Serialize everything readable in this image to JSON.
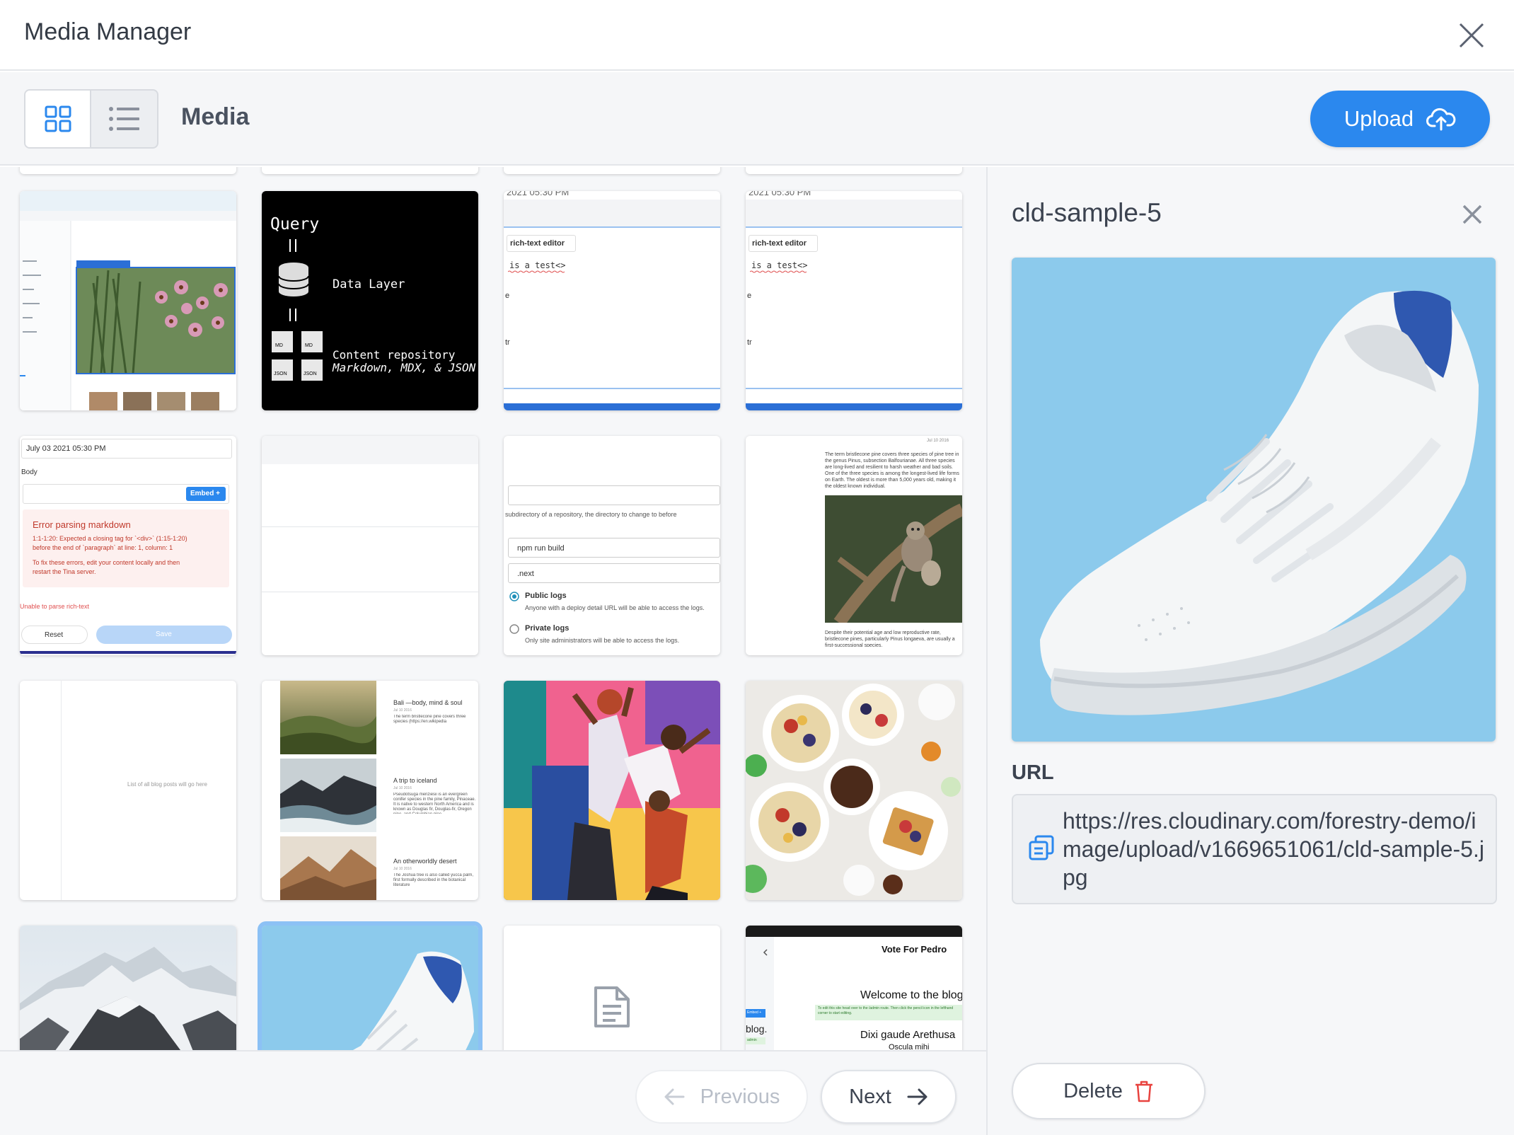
{
  "window": {
    "title": "Media Manager"
  },
  "toolbar": {
    "breadcrumb": "Media",
    "upload_label": "Upload"
  },
  "grid": {
    "tile2": {
      "query": "Query",
      "data_layer": "Data Layer",
      "content_repo": "Content repository",
      "content_formats": "Markdown, MDX, & JSON files",
      "md": "MD",
      "json": "JSON"
    },
    "tile3": {
      "date_partial": "2021 05:30 PM",
      "label": "rich-text editor",
      "code": "is a test<>",
      "line1": "e",
      "line2": "tr"
    },
    "tile4": {
      "date_partial": "2021 05:30 PM",
      "label": "rich-text editor",
      "code": "is a test<>",
      "line1": "e",
      "line2": "tr"
    },
    "tile5": {
      "date": "July 03 2021 05:30 PM",
      "body": "Body",
      "embed": "Embed +",
      "error_title": "Error parsing markdown",
      "error_1": "1:1-1:20: Expected a closing tag for `<div>` (1:15-1:20)",
      "error_2": "before the end of `paragraph` at line: 1, column: 1",
      "error_3": "To fix these errors, edit your content locally and then",
      "error_4": "restart the Tina server.",
      "unable": "Unable to parse rich-text",
      "reset": "Reset",
      "save": "Save"
    },
    "tile7": {
      "hint": "subdirectory of a repository, the directory to change to before",
      "cmd": "npm run build",
      "dir": ".next",
      "public_title": "Public logs",
      "public_desc": "Anyone with a deploy detail URL will be able to access the logs.",
      "private_title": "Private logs",
      "private_desc": "Only site administrators will be able to access the logs."
    },
    "tile8": {
      "date": "Jul 10 2016",
      "para": "The term bristlecone pine covers three species of pine tree in the genus Pinus, subsection Balfourianae. All three species are long-lived and resilient to harsh weather and bad soils. One of the three species is among the longest-lived life forms on Earth. The oldest is more than 5,000 years old, making it the oldest known individual.",
      "foot": "Despite their potential age and low reproductive rate, bristlecone pines, particularly Pinus longaeva, are usually a first-successional species."
    },
    "tile9": {
      "placeholder": "List of all blog posts will go here"
    },
    "tile10": {
      "post1_title": "Bali —body, mind & soul",
      "post1_date": "Jul 10 2016",
      "post1_text": "The term bristlecone pine covers three species (https://en.wikipedia",
      "post2_title": "A trip to iceland",
      "post2_date": "Jul 10 2016",
      "post2_text": "Pseudotsuga menziesii is an evergreen conifer species in the pine family, Pinaceae. It is native to western North America and is known as Douglas fir, Douglas-fir, Oregon pine, and Columbian pine.",
      "post3_title": "An otherworldly desert",
      "post3_date": "Jul 10 2016",
      "post3_text": "The Joshua tree is also called yucca palm, first formally described in the botanical literature"
    },
    "tile16": {
      "heading": "Vote For Pedro",
      "welcome": "Welcome to the blog.",
      "note": "To edit this site head over to the /admin route. Then click the pencil icon in the lefthand corner to start editing.",
      "blog_partial": "blog.",
      "dixi": "Dixi gaude Arethusa",
      "oscula": "Oscula mihi",
      "badge": "Embed +",
      "admin": "admin"
    }
  },
  "pagination": {
    "previous_label": "Previous",
    "next_label": "Next"
  },
  "details": {
    "filename": "cld-sample-5",
    "url_label": "URL",
    "url": "https://res.cloudinary.com/forestry-demo/image/upload/v1669651061/cld-sample-5.jpg",
    "delete_label": "Delete"
  },
  "colors": {
    "accent": "#2b88ee",
    "delete_icon": "#e8433f",
    "selection": "#8cc1f5",
    "sky_blue": "#8ccaec"
  }
}
